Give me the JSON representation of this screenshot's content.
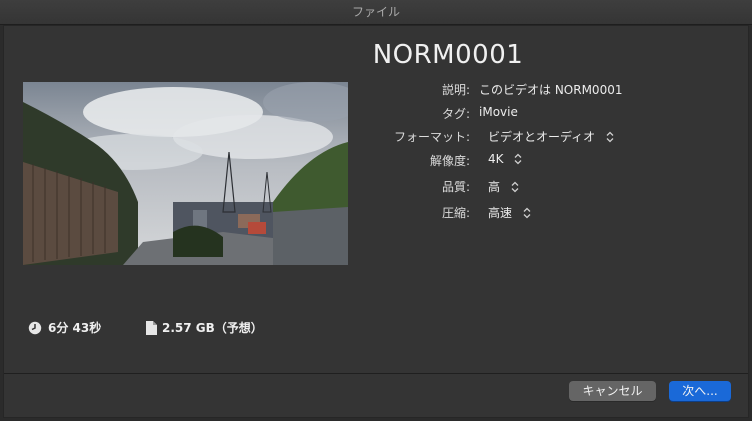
{
  "window": {
    "title": "ファイル"
  },
  "project": {
    "name": "NORM0001"
  },
  "fields": {
    "description": {
      "label": "説明:",
      "value": "このビデオは NORM0001"
    },
    "tags": {
      "label": "タグ:",
      "value": "iMovie"
    },
    "format": {
      "label": "フォーマット:",
      "value": "ビデオとオーディオ"
    },
    "resolution": {
      "label": "解像度:",
      "value": "4K"
    },
    "quality": {
      "label": "品質:",
      "value": "高"
    },
    "compression": {
      "label": "圧縮:",
      "value": "高速"
    }
  },
  "stats": {
    "duration": {
      "icon": "clock-icon",
      "value": "6分 43秒"
    },
    "size": {
      "icon": "document-icon",
      "value": "2.57 GB（予想）"
    }
  },
  "buttons": {
    "cancel_label": "キャンセル",
    "next_label": "次へ..."
  },
  "colors": {
    "accent": "#1a69d8",
    "sheet_background": "#343434"
  }
}
